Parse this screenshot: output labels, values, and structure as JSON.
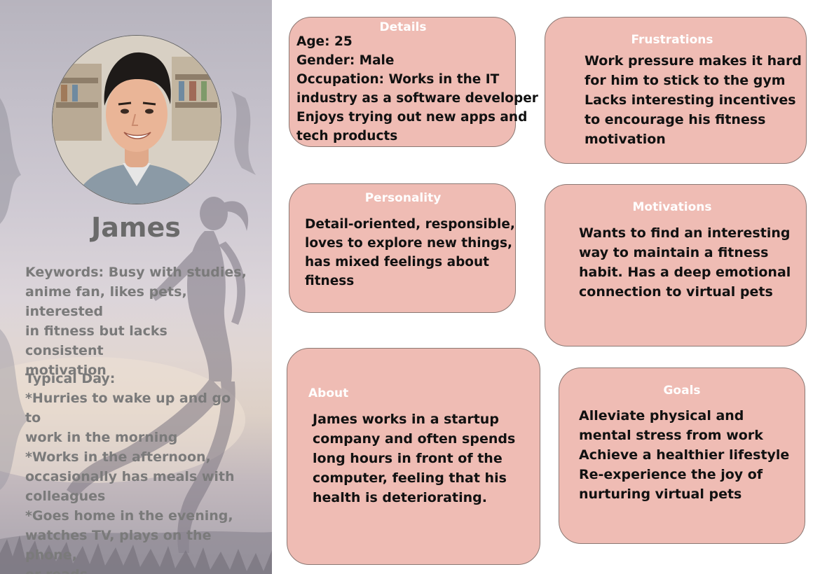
{
  "persona": {
    "name": "James",
    "keywords": [
      "Keywords: Busy with studies,",
      "anime fan, likes pets, interested",
      "in fitness but lacks consistent",
      "motivation"
    ],
    "typical_day": [
      "Typical Day:",
      "*Hurries to wake up and go to",
      "work in the morning",
      "*Works in the afternoon,",
      "occasionally has meals with",
      "colleagues",
      "*Goes home in the evening,",
      "watches TV, plays on the phone,",
      "or reads"
    ]
  },
  "cards": {
    "details": {
      "title": "Details",
      "lines": [
        "Age: 25",
        "Gender: Male",
        "Occupation: Works in the IT",
        "industry as a software developer",
        "Enjoys trying out new apps and",
        "tech products"
      ]
    },
    "frustrations": {
      "title": "Frustrations",
      "lines": [
        "Work pressure makes it hard",
        "for him to stick to the gym",
        "Lacks interesting incentives",
        "to encourage his fitness",
        "motivation"
      ]
    },
    "personality": {
      "title": "Personality",
      "lines": [
        "Detail-oriented, responsible,",
        "loves to explore new things,",
        "has mixed feelings about",
        "fitness"
      ]
    },
    "motivations": {
      "title": "Motivations",
      "lines": [
        "Wants to find an interesting",
        "way to maintain a fitness",
        "habit. Has a deep emotional",
        "connection to virtual pets"
      ]
    },
    "about": {
      "title": "About",
      "lines": [
        "James works in a startup",
        "company and often spends",
        "long hours in front of the",
        "computer, feeling that his",
        "health is deteriorating."
      ]
    },
    "goals": {
      "title": "Goals",
      "lines": [
        "Alleviate physical and",
        "mental stress from work",
        "Achieve a healthier lifestyle",
        "Re-experience the joy of",
        "nurturing virtual pets"
      ]
    }
  },
  "colors": {
    "card_fill": "#efbcb4",
    "card_border": "#8b7772",
    "card_title": "#ffffff",
    "sidebar_text": "#7a7a7a",
    "name_text": "#6a6a6a"
  }
}
